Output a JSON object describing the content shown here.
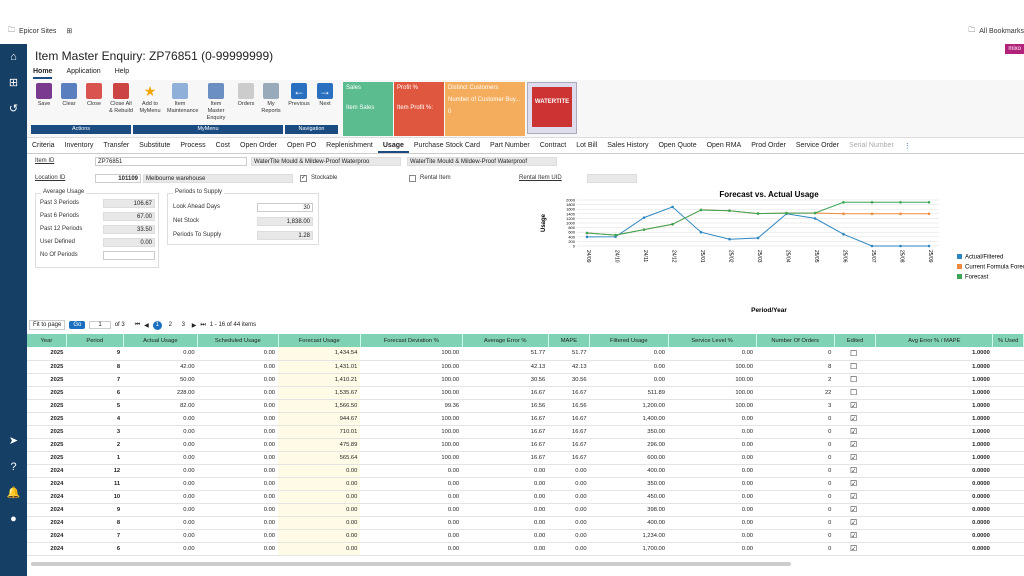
{
  "browser": {
    "site": "Epicor Sites",
    "bookmarks": "All Bookmarks"
  },
  "title": "Item Master Enquiry: ZP76851 (0-99999999)",
  "badge": "mixo",
  "menu": [
    "Home",
    "Application",
    "Help"
  ],
  "ribbon": {
    "buttons": [
      "Save",
      "Clear",
      "Close",
      "Close All & Rebuild",
      "Add to MyMenu",
      "Item Maintenance",
      "Item Master Enquiry",
      "Orders",
      "My Reports",
      "Previous",
      "Next"
    ],
    "groups": [
      "Actions",
      "MyMenu",
      "Navigation"
    ],
    "tiles": [
      {
        "color": "#5bbc8f",
        "l1": "Sales",
        "l2": "Item Sales"
      },
      {
        "color": "#e0573f",
        "l1": "Profit %",
        "l2": "Item Profit %:"
      },
      {
        "color": "#f4ad5d",
        "l1": "Distinct Customers",
        "l2": "Number of Customer Buy...",
        "l3": "0"
      }
    ],
    "product": "WATERTITE"
  },
  "tabs": [
    "Criteria",
    "Inventory",
    "Transfer",
    "Substitute",
    "Process",
    "Cost",
    "Open Order",
    "Open PO",
    "Replenishment",
    "Usage",
    "Purchase Stock Card",
    "Part Number",
    "Contract",
    "Lot Bill",
    "Sales History",
    "Open Quote",
    "Open RMA",
    "Prod Order",
    "Service Order",
    "Serial Number"
  ],
  "form": {
    "item_id_label": "Item ID",
    "item_id": "ZP76851",
    "desc1": "WaterTite Mould & Mildew-Proof Waterproo",
    "desc2": "WaterTite Mould & Mildew-Proof Waterproof",
    "loc_label": "Location ID",
    "loc_id": "101109",
    "loc_name": "Melbourne warehouse",
    "stockable": "Stockable",
    "rental": "Rental Item",
    "rental_uid": "Rental Item UID"
  },
  "avg_usage": {
    "title": "Average Usage",
    "rows": [
      [
        "Past 3 Periods",
        "106.67"
      ],
      [
        "Past 6 Periods",
        "67.00"
      ],
      [
        "Past 12 Periods",
        "33.50"
      ],
      [
        "User Defined",
        "0.00"
      ],
      [
        "No Of Periods",
        ""
      ]
    ]
  },
  "supply": {
    "title": "Periods to Supply",
    "rows": [
      [
        "Look Ahead Days",
        "30"
      ],
      [
        "Net Stock",
        "1,838.00"
      ],
      [
        "Periods To Supply",
        "1.28"
      ]
    ]
  },
  "chart_data": {
    "type": "line",
    "title": "Forecast vs. Actual Usage",
    "xlabel": "Period/Year",
    "ylabel": "Usage",
    "categories": [
      "24/09",
      "24/10",
      "24/11",
      "24/12",
      "25/01",
      "25/02",
      "25/03",
      "25/04",
      "25/05",
      "25/06",
      "25/07",
      "25/08",
      "25/09"
    ],
    "series": [
      {
        "name": "Actual/Filtered",
        "color": "#2e86c1",
        "values": [
          398,
          400,
          1234,
          1700,
          600,
          296,
          350,
          1400,
          1200,
          512,
          0,
          0,
          0
        ]
      },
      {
        "name": "Current Formula Forecast",
        "color": "#f0883a",
        "values": [
          565,
          475,
          710,
          944,
          1566,
          1535,
          1410,
          1431,
          1435,
          1400,
          1400,
          1400,
          1400
        ]
      },
      {
        "name": "Forecast",
        "color": "#3aa655",
        "values": [
          565,
          475,
          710,
          944,
          1566,
          1535,
          1410,
          1431,
          1435,
          1900,
          1900,
          1900,
          1900
        ]
      }
    ],
    "yticks": [
      "2000",
      "1800",
      "1600",
      "1400",
      "1200",
      "1000",
      "800",
      "600",
      "400",
      "200",
      "0"
    ],
    "ylim": [
      0,
      2000
    ]
  },
  "pager": {
    "fit": "Fit to page",
    "go": "Go",
    "page": "1",
    "of": "of 3",
    "pages": [
      "1",
      "2",
      "3"
    ],
    "range": "1 - 16 of 44 items"
  },
  "table": {
    "headers": [
      "Year",
      "Period",
      "Actual Usage",
      "Scheduled Usage",
      "Forecast Usage",
      "Forecast Deviation %",
      "Average Error %",
      "MAPE",
      "Filtered Usage",
      "Service Level %",
      "Number Of Orders",
      "Edited",
      "Avg Error % / MAPE",
      "% Used"
    ],
    "rows": [
      [
        "2025",
        "9",
        "0.00",
        "0.00",
        "1,434.54",
        "100.00",
        "51.77",
        "51.77",
        "0.00",
        "0.00",
        "0",
        false,
        "1.0000"
      ],
      [
        "2025",
        "8",
        "42.00",
        "0.00",
        "1,431.01",
        "100.00",
        "42.13",
        "42.13",
        "0.00",
        "100.00",
        "8",
        false,
        "1.0000"
      ],
      [
        "2025",
        "7",
        "50.00",
        "0.00",
        "1,410.21",
        "100.00",
        "30.56",
        "30.56",
        "0.00",
        "100.00",
        "2",
        false,
        "1.0000"
      ],
      [
        "2025",
        "6",
        "228.00",
        "0.00",
        "1,535.67",
        "100.00",
        "16.67",
        "16.67",
        "511.89",
        "100.00",
        "22",
        false,
        "1.0000"
      ],
      [
        "2025",
        "5",
        "82.00",
        "0.00",
        "1,566.50",
        "99.36",
        "16.56",
        "16.56",
        "1,200.00",
        "100.00",
        "3",
        true,
        "1.0000"
      ],
      [
        "2025",
        "4",
        "0.00",
        "0.00",
        "944.67",
        "100.00",
        "16.67",
        "16.67",
        "1,400.00",
        "0.00",
        "0",
        true,
        "1.0000"
      ],
      [
        "2025",
        "3",
        "0.00",
        "0.00",
        "710.01",
        "100.00",
        "16.67",
        "16.67",
        "350.00",
        "0.00",
        "0",
        true,
        "1.0000"
      ],
      [
        "2025",
        "2",
        "0.00",
        "0.00",
        "475.89",
        "100.00",
        "16.67",
        "16.67",
        "296.00",
        "0.00",
        "0",
        true,
        "1.0000"
      ],
      [
        "2025",
        "1",
        "0.00",
        "0.00",
        "565.64",
        "100.00",
        "16.67",
        "16.67",
        "600.00",
        "0.00",
        "0",
        true,
        "1.0000"
      ],
      [
        "2024",
        "12",
        "0.00",
        "0.00",
        "0.00",
        "0.00",
        "0.00",
        "0.00",
        "400.00",
        "0.00",
        "0",
        true,
        "0.0000"
      ],
      [
        "2024",
        "11",
        "0.00",
        "0.00",
        "0.00",
        "0.00",
        "0.00",
        "0.00",
        "350.00",
        "0.00",
        "0",
        true,
        "0.0000"
      ],
      [
        "2024",
        "10",
        "0.00",
        "0.00",
        "0.00",
        "0.00",
        "0.00",
        "0.00",
        "450.00",
        "0.00",
        "0",
        true,
        "0.0000"
      ],
      [
        "2024",
        "9",
        "0.00",
        "0.00",
        "0.00",
        "0.00",
        "0.00",
        "0.00",
        "398.00",
        "0.00",
        "0",
        true,
        "0.0000"
      ],
      [
        "2024",
        "8",
        "0.00",
        "0.00",
        "0.00",
        "0.00",
        "0.00",
        "0.00",
        "400.00",
        "0.00",
        "0",
        true,
        "0.0000"
      ],
      [
        "2024",
        "7",
        "0.00",
        "0.00",
        "0.00",
        "0.00",
        "0.00",
        "0.00",
        "1,234.00",
        "0.00",
        "0",
        true,
        "0.0000"
      ],
      [
        "2024",
        "6",
        "0.00",
        "0.00",
        "0.00",
        "0.00",
        "0.00",
        "0.00",
        "1,700.00",
        "0.00",
        "0",
        true,
        "0.0000"
      ]
    ]
  }
}
